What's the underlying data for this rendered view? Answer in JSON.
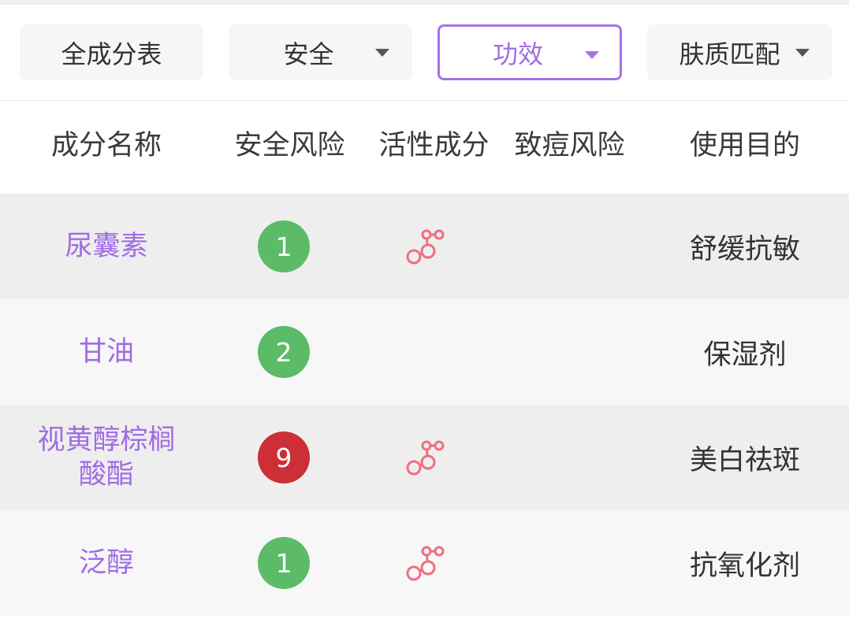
{
  "filters": [
    {
      "label": "全成分表",
      "has_dropdown": false,
      "active": false
    },
    {
      "label": "安全",
      "has_dropdown": true,
      "active": false
    },
    {
      "label": "功效",
      "has_dropdown": true,
      "active": true
    },
    {
      "label": "肤质匹配",
      "has_dropdown": true,
      "active": false
    }
  ],
  "table": {
    "headers": [
      "成分名称",
      "安全风险",
      "活性成分",
      "致痘风险",
      "使用目的"
    ],
    "rows": [
      {
        "name": "尿囊素",
        "risk": "1",
        "risk_level": "low",
        "active": true,
        "acne": "",
        "purpose": "舒缓抗敏"
      },
      {
        "name": "甘油",
        "risk": "2",
        "risk_level": "low",
        "active": false,
        "acne": "",
        "purpose": "保湿剂"
      },
      {
        "name_line1": "视黄醇棕榈",
        "name_line2": "酸酯",
        "risk": "9",
        "risk_level": "high",
        "active": true,
        "acne": "",
        "purpose": "美白祛斑"
      },
      {
        "name": "泛醇",
        "risk": "1",
        "risk_level": "low",
        "active": true,
        "acne": "",
        "purpose": "抗氧化剂"
      }
    ]
  },
  "colors": {
    "accent": "#a06ce4",
    "risk_low": "#5cbb67",
    "risk_high": "#cc2f36",
    "active_icon": "#ef6f7e"
  },
  "icons": {
    "dropdown": "caret-down-icon",
    "active_ingredient": "molecule-icon"
  }
}
